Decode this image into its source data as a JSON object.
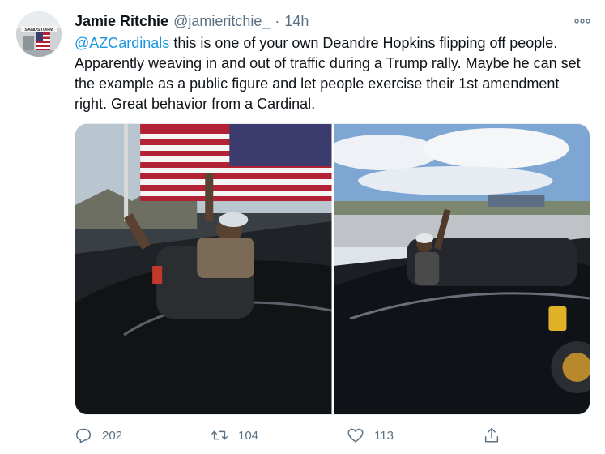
{
  "user": {
    "name": "Jamie Ritchie",
    "handle": "@jamieritchie_",
    "separator": "·",
    "time": "14h",
    "avatar_sign": "SANDSTORM"
  },
  "tweet": {
    "mention": "@AZCardinals",
    "body": " this is one of your own Deandre Hopkins flipping off people. Apparently weaving in and out of traffic during a Trump rally.  Maybe he can set the example as a public figure and let people exercise their 1st amendment right.  Great behavior from a Cardinal."
  },
  "media": {
    "count": 2
  },
  "actions": {
    "reply_count": "202",
    "retweet_count": "104",
    "like_count": "113"
  },
  "colors": {
    "text": "#0f1419",
    "secondary": "#5b7083",
    "link": "#1b95e0"
  }
}
